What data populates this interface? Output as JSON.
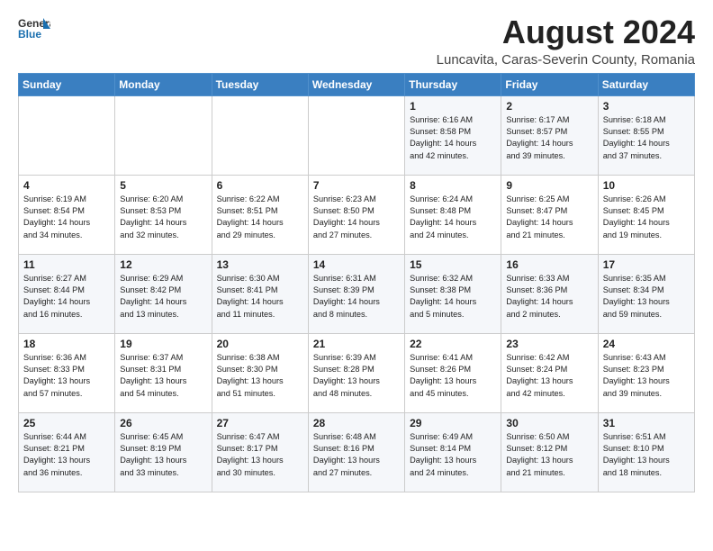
{
  "header": {
    "logo_general": "General",
    "logo_blue": "Blue",
    "title": "August 2024",
    "location": "Luncavita, Caras-Severin County, Romania"
  },
  "days_of_week": [
    "Sunday",
    "Monday",
    "Tuesday",
    "Wednesday",
    "Thursday",
    "Friday",
    "Saturday"
  ],
  "weeks": [
    [
      {
        "day": "",
        "info": ""
      },
      {
        "day": "",
        "info": ""
      },
      {
        "day": "",
        "info": ""
      },
      {
        "day": "",
        "info": ""
      },
      {
        "day": "1",
        "info": "Sunrise: 6:16 AM\nSunset: 8:58 PM\nDaylight: 14 hours\nand 42 minutes."
      },
      {
        "day": "2",
        "info": "Sunrise: 6:17 AM\nSunset: 8:57 PM\nDaylight: 14 hours\nand 39 minutes."
      },
      {
        "day": "3",
        "info": "Sunrise: 6:18 AM\nSunset: 8:55 PM\nDaylight: 14 hours\nand 37 minutes."
      }
    ],
    [
      {
        "day": "4",
        "info": "Sunrise: 6:19 AM\nSunset: 8:54 PM\nDaylight: 14 hours\nand 34 minutes."
      },
      {
        "day": "5",
        "info": "Sunrise: 6:20 AM\nSunset: 8:53 PM\nDaylight: 14 hours\nand 32 minutes."
      },
      {
        "day": "6",
        "info": "Sunrise: 6:22 AM\nSunset: 8:51 PM\nDaylight: 14 hours\nand 29 minutes."
      },
      {
        "day": "7",
        "info": "Sunrise: 6:23 AM\nSunset: 8:50 PM\nDaylight: 14 hours\nand 27 minutes."
      },
      {
        "day": "8",
        "info": "Sunrise: 6:24 AM\nSunset: 8:48 PM\nDaylight: 14 hours\nand 24 minutes."
      },
      {
        "day": "9",
        "info": "Sunrise: 6:25 AM\nSunset: 8:47 PM\nDaylight: 14 hours\nand 21 minutes."
      },
      {
        "day": "10",
        "info": "Sunrise: 6:26 AM\nSunset: 8:45 PM\nDaylight: 14 hours\nand 19 minutes."
      }
    ],
    [
      {
        "day": "11",
        "info": "Sunrise: 6:27 AM\nSunset: 8:44 PM\nDaylight: 14 hours\nand 16 minutes."
      },
      {
        "day": "12",
        "info": "Sunrise: 6:29 AM\nSunset: 8:42 PM\nDaylight: 14 hours\nand 13 minutes."
      },
      {
        "day": "13",
        "info": "Sunrise: 6:30 AM\nSunset: 8:41 PM\nDaylight: 14 hours\nand 11 minutes."
      },
      {
        "day": "14",
        "info": "Sunrise: 6:31 AM\nSunset: 8:39 PM\nDaylight: 14 hours\nand 8 minutes."
      },
      {
        "day": "15",
        "info": "Sunrise: 6:32 AM\nSunset: 8:38 PM\nDaylight: 14 hours\nand 5 minutes."
      },
      {
        "day": "16",
        "info": "Sunrise: 6:33 AM\nSunset: 8:36 PM\nDaylight: 14 hours\nand 2 minutes."
      },
      {
        "day": "17",
        "info": "Sunrise: 6:35 AM\nSunset: 8:34 PM\nDaylight: 13 hours\nand 59 minutes."
      }
    ],
    [
      {
        "day": "18",
        "info": "Sunrise: 6:36 AM\nSunset: 8:33 PM\nDaylight: 13 hours\nand 57 minutes."
      },
      {
        "day": "19",
        "info": "Sunrise: 6:37 AM\nSunset: 8:31 PM\nDaylight: 13 hours\nand 54 minutes."
      },
      {
        "day": "20",
        "info": "Sunrise: 6:38 AM\nSunset: 8:30 PM\nDaylight: 13 hours\nand 51 minutes."
      },
      {
        "day": "21",
        "info": "Sunrise: 6:39 AM\nSunset: 8:28 PM\nDaylight: 13 hours\nand 48 minutes."
      },
      {
        "day": "22",
        "info": "Sunrise: 6:41 AM\nSunset: 8:26 PM\nDaylight: 13 hours\nand 45 minutes."
      },
      {
        "day": "23",
        "info": "Sunrise: 6:42 AM\nSunset: 8:24 PM\nDaylight: 13 hours\nand 42 minutes."
      },
      {
        "day": "24",
        "info": "Sunrise: 6:43 AM\nSunset: 8:23 PM\nDaylight: 13 hours\nand 39 minutes."
      }
    ],
    [
      {
        "day": "25",
        "info": "Sunrise: 6:44 AM\nSunset: 8:21 PM\nDaylight: 13 hours\nand 36 minutes."
      },
      {
        "day": "26",
        "info": "Sunrise: 6:45 AM\nSunset: 8:19 PM\nDaylight: 13 hours\nand 33 minutes."
      },
      {
        "day": "27",
        "info": "Sunrise: 6:47 AM\nSunset: 8:17 PM\nDaylight: 13 hours\nand 30 minutes."
      },
      {
        "day": "28",
        "info": "Sunrise: 6:48 AM\nSunset: 8:16 PM\nDaylight: 13 hours\nand 27 minutes."
      },
      {
        "day": "29",
        "info": "Sunrise: 6:49 AM\nSunset: 8:14 PM\nDaylight: 13 hours\nand 24 minutes."
      },
      {
        "day": "30",
        "info": "Sunrise: 6:50 AM\nSunset: 8:12 PM\nDaylight: 13 hours\nand 21 minutes."
      },
      {
        "day": "31",
        "info": "Sunrise: 6:51 AM\nSunset: 8:10 PM\nDaylight: 13 hours\nand 18 minutes."
      }
    ]
  ]
}
